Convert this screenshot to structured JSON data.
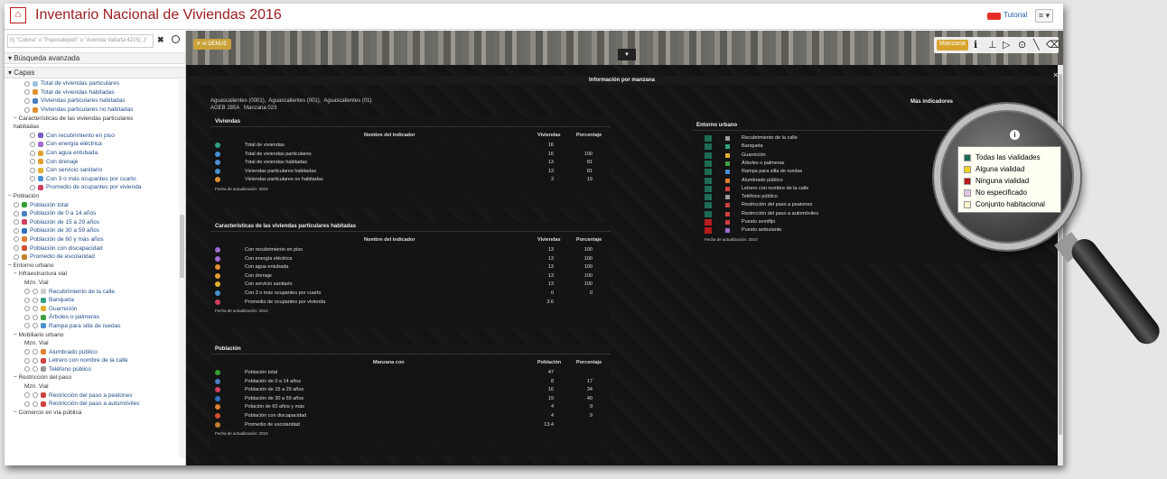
{
  "header": {
    "title": "Inventario Nacional de Viviendas 2016",
    "tutorial": "Tutorial",
    "menu": "≡ ▾"
  },
  "search": {
    "placeholder": "Ej \"Colima\" o \"Popocatepetl\" o \"Avenida Vallarta 4215(..)\"",
    "clear": "✖"
  },
  "sidebar": {
    "advanced": "Búsqueda avanzada",
    "layers": "Capas",
    "items": [
      {
        "t": "Total de viviendas particulares",
        "ind": 3,
        "rb": 1,
        "c": "#9fc2e0"
      },
      {
        "t": "Total de viviendas habitadas",
        "ind": 3,
        "rb": 1,
        "c": "#e09030"
      },
      {
        "t": "Viviendas particulares habitadas",
        "ind": 3,
        "rb": 1,
        "c": "#4a7fc0"
      },
      {
        "t": "Viviendas particulares no habitadas",
        "ind": 3,
        "rb": 1,
        "c": "#e09030"
      },
      {
        "t": "− Características de las viviendas particulares",
        "ind": 1,
        "h": 1
      },
      {
        "t": "habitadas",
        "ind": 1,
        "h": 1
      },
      {
        "t": "Con recubrimiento en piso",
        "ind": 4,
        "rb": 1,
        "c": "#7a5cc6"
      },
      {
        "t": "Con energía eléctrica",
        "ind": 4,
        "rb": 1,
        "c": "#9f6bd0"
      },
      {
        "t": "Con agua entubada",
        "ind": 4,
        "rb": 1,
        "c": "#e0a030"
      },
      {
        "t": "Con drenaje",
        "ind": 4,
        "rb": 1,
        "c": "#e0a030"
      },
      {
        "t": "Con servicio sanitario",
        "ind": 4,
        "rb": 1,
        "c": "#e0b030"
      },
      {
        "t": "Con 3 o más ocupantes por cuarto",
        "ind": 4,
        "rb": 1,
        "c": "#4a90d0"
      },
      {
        "t": "Promedio de ocupantes por vivienda",
        "ind": 4,
        "rb": 1,
        "c": "#d04060"
      },
      {
        "t": "− Población",
        "ind": 0,
        "h": 1
      },
      {
        "t": "Población total",
        "ind": 1,
        "rb": 1,
        "c": "#30a030"
      },
      {
        "t": "Población de 0 a 14 años",
        "ind": 1,
        "rb": 1,
        "c": "#4a7fc0"
      },
      {
        "t": "Población de 15 a 29 años",
        "ind": 1,
        "rb": 1,
        "c": "#d04060"
      },
      {
        "t": "Población de 30 a 59 años",
        "ind": 1,
        "rb": 1,
        "c": "#3070c0"
      },
      {
        "t": "Población de 60 y más años",
        "ind": 1,
        "rb": 1,
        "c": "#e08030"
      },
      {
        "t": "Población con discapacidad",
        "ind": 1,
        "rb": 1,
        "c": "#d05030"
      },
      {
        "t": "Promedio de escolaridad",
        "ind": 1,
        "rb": 1,
        "c": "#c08030"
      },
      {
        "t": "− Entorno urbano",
        "ind": 0,
        "h": 1
      },
      {
        "t": "− Infraestructura vial",
        "ind": 1,
        "h": 1
      },
      {
        "t": "Mzn.  Vial",
        "ind": 3,
        "h": 1
      },
      {
        "t": "Recubrimiento de la calle",
        "ind": 3,
        "rb": 2,
        "c": "#cccccc"
      },
      {
        "t": "Banqueta",
        "ind": 3,
        "rb": 2,
        "c": "#30a080"
      },
      {
        "t": "Guarnición",
        "ind": 3,
        "rb": 2,
        "c": "#e0b030"
      },
      {
        "t": "Árboles o palmeras",
        "ind": 3,
        "rb": 2,
        "c": "#40a040"
      },
      {
        "t": "Rampa para silla de ruedas",
        "ind": 3,
        "rb": 2,
        "c": "#4a90d0"
      },
      {
        "t": "− Mobiliario urbano",
        "ind": 1,
        "h": 1
      },
      {
        "t": "Mzn.  Vial",
        "ind": 3,
        "h": 1
      },
      {
        "t": "Alumbrado público",
        "ind": 3,
        "rb": 2,
        "c": "#e08030"
      },
      {
        "t": "Letrero con nombre de la calle",
        "ind": 3,
        "rb": 2,
        "c": "#d04040"
      },
      {
        "t": "Teléfono público",
        "ind": 3,
        "rb": 2,
        "c": "#999999"
      },
      {
        "t": "− Restricción del paso",
        "ind": 1,
        "h": 1
      },
      {
        "t": "Mzn.  Vial",
        "ind": 3,
        "h": 1
      },
      {
        "t": "Restricción del paso a peatones",
        "ind": 3,
        "rb": 2,
        "c": "#d04040"
      },
      {
        "t": "Restricción del paso a automóviles",
        "ind": 3,
        "rb": 2,
        "c": "#d04040"
      },
      {
        "t": "− Comercio en vía pública",
        "ind": 1,
        "h": 1
      }
    ]
  },
  "map": {
    "denue": "☀ el DENUE",
    "manzana": "Manzana",
    "tool_icons": [
      "ℹ",
      "⊥",
      "▷",
      "⊙",
      "╲",
      "⌫"
    ],
    "expand": "▾"
  },
  "panel": {
    "title": "Información por manzana",
    "close": "×",
    "location": "Aguascalientes (0001),  Aguascalientes (001),  Aguascalientes (01)\nAGEB 285A   Manzana 023",
    "more": "Más indicadores",
    "viviendas": {
      "title": "Viviendas",
      "h_name": "Nombre del indicador",
      "h_a": "Viviendas",
      "h_b": "Porcentaje",
      "rows": [
        [
          "Total de viviendas",
          "16",
          ""
        ],
        [
          "Total de viviendas particulares",
          "16",
          "100"
        ],
        [
          "Total de viviendas habitadas",
          "13",
          "81"
        ],
        [
          "Viviendas particulares habitadas",
          "13",
          "81"
        ],
        [
          "Viviendas particulares no habitadas",
          "3",
          "19"
        ]
      ],
      "colors": [
        "#30a080",
        "#4a90d0",
        "#4a90d0",
        "#4a90d0",
        "#e09030"
      ],
      "footer": "Fecha de actualización: 2010"
    },
    "caract": {
      "title": "Características de las viviendas particulares habitadas",
      "h_name": "Nombre del indicador",
      "h_a": "Viviendas",
      "h_b": "Porcentaje",
      "rows": [
        [
          "Con recubrimiento en piso",
          "13",
          "100"
        ],
        [
          "Con energía eléctrica",
          "13",
          "100"
        ],
        [
          "Con agua entubada",
          "13",
          "100"
        ],
        [
          "Con drenaje",
          "13",
          "100"
        ],
        [
          "Con servicio sanitario",
          "13",
          "100"
        ],
        [
          "Con 3 o más ocupantes por cuarto",
          "0",
          "0"
        ],
        [
          "Promedio de ocupantes por vivienda",
          "3.6",
          ""
        ]
      ],
      "colors": [
        "#9f6bd0",
        "#9f6bd0",
        "#e09030",
        "#e0a030",
        "#e0b030",
        "#4a90d0",
        "#d04060"
      ],
      "footer": "Fecha de actualización: 2010"
    },
    "poblacion": {
      "title": "Población",
      "h_name": "Manzana con",
      "h_a": "Población",
      "h_b": "Porcentaje",
      "rows": [
        [
          "Población total",
          "47",
          ""
        ],
        [
          "Población de 0 a 14 años",
          "8",
          "17"
        ],
        [
          "Población de 15 a 29 años",
          "16",
          "34"
        ],
        [
          "Población de 30 a 59 años",
          "19",
          "40"
        ],
        [
          "Polación de 60 años y más",
          "4",
          "9"
        ],
        [
          "Población con discapacidad",
          "4",
          "9"
        ],
        [
          "Promedio de escolaridad",
          "13.4",
          ""
        ]
      ],
      "colors": [
        "#30a030",
        "#4a7fc0",
        "#d04060",
        "#3070c0",
        "#e08030",
        "#d05030",
        "#c08030"
      ],
      "footer": "Fecha de actualización: 2010"
    },
    "entorno": {
      "title": "Entorno urbano",
      "rows": [
        "Recubrimiento de la calle",
        "Banqueta",
        "Guarnición",
        "Árboles o palmeras",
        "Rampa para silla de ruedas",
        "Alumbrado público",
        "Letrero con nombre de la calle",
        "Teléfono público",
        "Restricción del paso a peatones",
        "Restricción del paso a automóviles",
        "Puesto semifijo",
        "Puesto ambulante"
      ],
      "c1": [
        "#1e6b55",
        "#1e6b55",
        "#1e6b55",
        "#1e6b55",
        "#1e6b55",
        "#1e6b55",
        "#1e6b55",
        "#1e6b55",
        "#1e6b55",
        "#1e6b55",
        "#b71c1c",
        "#b71c1c"
      ],
      "c2": [
        "#999",
        "#30a080",
        "#e0b030",
        "#40a040",
        "#4a90d0",
        "#e08030",
        "#d04040",
        "#999",
        "#d04040",
        "#d04040",
        "#d04040",
        "#9f6bd0"
      ],
      "footer": "Fecha de actualización: 2010"
    }
  },
  "legend": {
    "info": "i",
    "items": [
      {
        "t": "Todas las vialidades",
        "c": "#1e6b55"
      },
      {
        "t": "Alguna vialidad",
        "c": "#f2d21b"
      },
      {
        "t": "Ninguna vialidad",
        "c": "#b71c1c"
      },
      {
        "t": "No especificado",
        "c": "#e0c4e0"
      },
      {
        "t": "Conjunto habitacional",
        "c": "#fbf6d0"
      }
    ]
  }
}
